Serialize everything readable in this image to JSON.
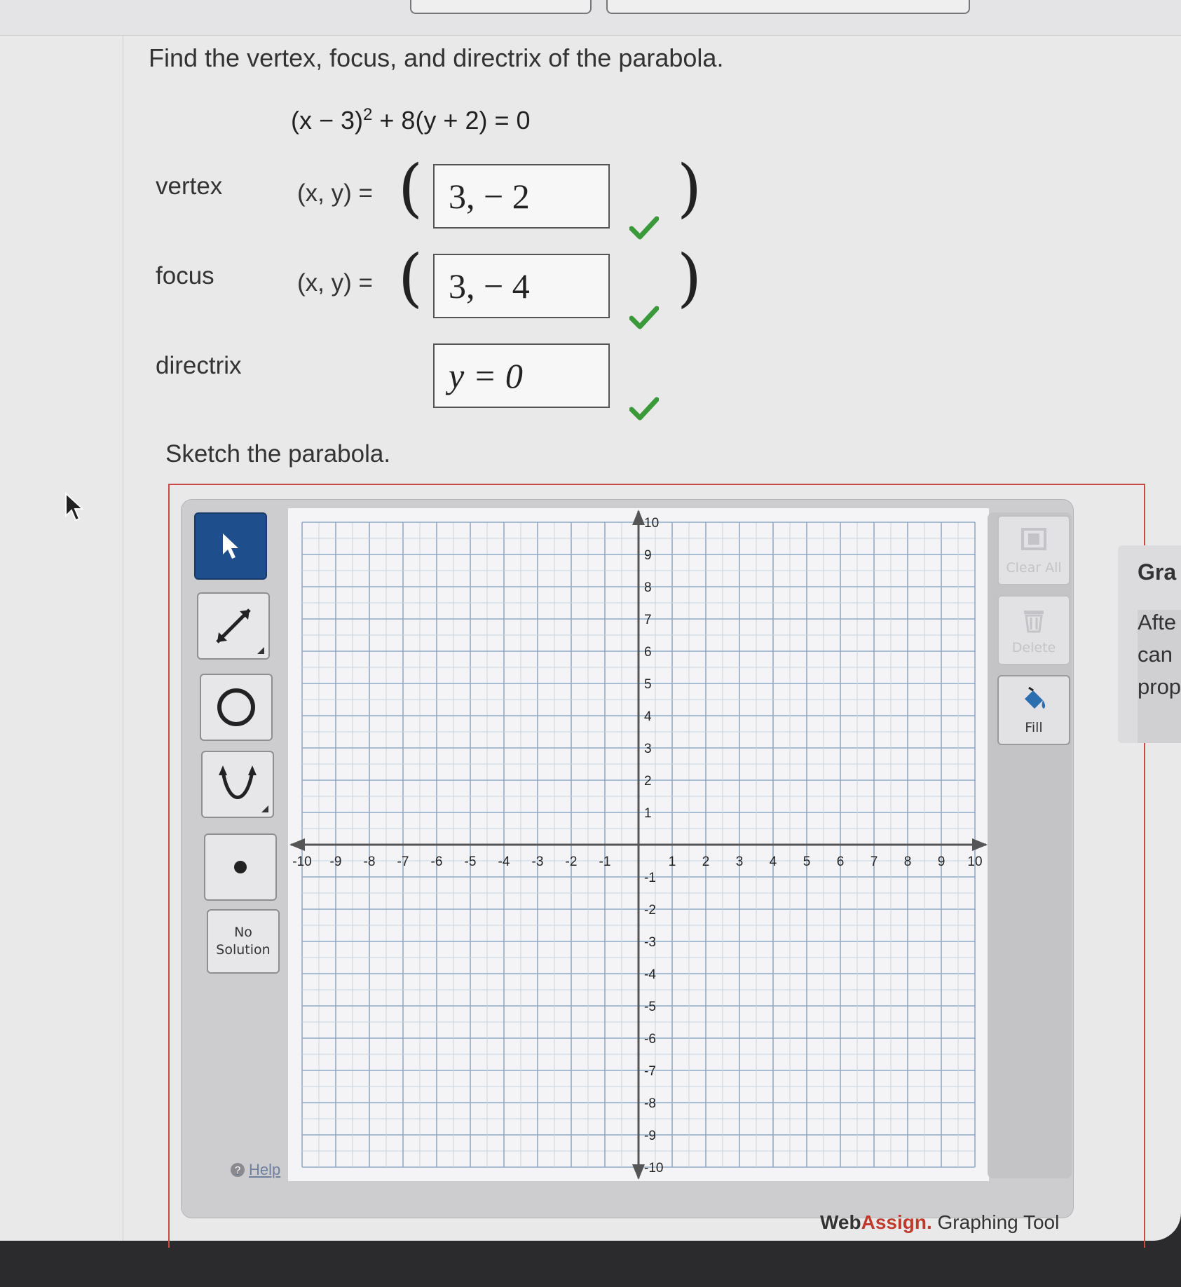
{
  "question": {
    "title": "Find the vertex, focus, and directrix of the parabola.",
    "equation": {
      "left": "(x − 3)",
      "power": "2",
      "right": " + 8(y + 2) = 0"
    }
  },
  "rows": [
    {
      "label": "vertex",
      "xy_label": "(x, y)  =",
      "value": "3, − 2",
      "correct": true
    },
    {
      "label": "focus",
      "xy_label": "(x, y)  =",
      "value": "3, − 4",
      "correct": true
    },
    {
      "label": "directrix",
      "xy_label": "",
      "value": "y = 0",
      "correct": true
    }
  ],
  "sketch_label": "Sketch the parabola.",
  "graph_tool": {
    "tools": [
      {
        "name": "pointer-tool",
        "icon": "cursor-arrow-icon",
        "active": true
      },
      {
        "name": "line-tool",
        "icon": "double-arrow-line-icon",
        "active": false
      },
      {
        "name": "circle-tool",
        "icon": "circle-icon",
        "active": false
      },
      {
        "name": "parabola-tool",
        "icon": "parabola-icon",
        "active": false
      },
      {
        "name": "point-tool",
        "icon": "point-dot-icon",
        "active": false
      }
    ],
    "no_solution_line1": "No",
    "no_solution_line2": "Solution",
    "help_label": "Help",
    "clear_all_label": "Clear All",
    "delete_label": "Delete",
    "fill_label": "Fill",
    "axis": {
      "x_ticks": [
        "-10",
        "-9",
        "-8",
        "-7",
        "-6",
        "-5",
        "-4",
        "-3",
        "-2",
        "-1",
        "1",
        "2",
        "3",
        "4",
        "5",
        "6",
        "7",
        "8",
        "9",
        "10"
      ],
      "y_ticks": [
        "10",
        "9",
        "8",
        "7",
        "6",
        "5",
        "4",
        "3",
        "2",
        "1",
        "-1",
        "-2",
        "-3",
        "-4",
        "-5",
        "-6",
        "-7",
        "-8",
        "-9",
        "-10"
      ],
      "range": [
        -10,
        10
      ]
    },
    "brand_web": "Web",
    "brand_assign": "Assign.",
    "brand_tool": " Graphing Tool"
  },
  "side_panel": {
    "title": "Gra",
    "lines": [
      "Afte",
      "can",
      "prop"
    ]
  },
  "colors": {
    "check_green": "#3a9a3a",
    "active_tool": "#1f4e8c",
    "frame_red": "#c94a4a"
  }
}
